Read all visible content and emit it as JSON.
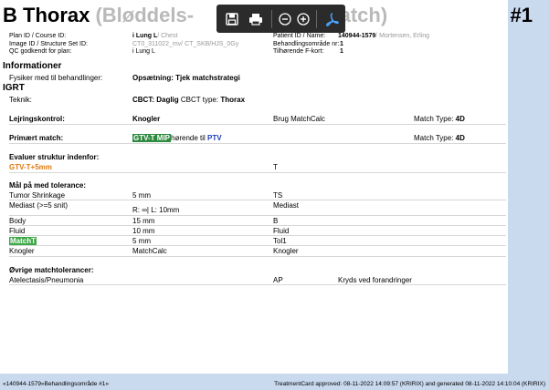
{
  "header": {
    "title_main": "B Thorax",
    "title_ghost_left": " (Bløddels-",
    "title_ghost_right": "match)",
    "number": "#1"
  },
  "toolbar": {
    "icons": [
      "save-icon",
      "print-icon",
      "zoom-out-icon",
      "zoom-in-icon",
      "pdf-icon"
    ]
  },
  "meta": {
    "plan_label": "Plan ID / Course ID:",
    "plan_value": "i Lung L",
    "plan_sub": "/ Chest",
    "image_label": "Image ID / Structure Set ID:",
    "image_value": "CT0_311022_mv/ CT_SKB/HJS_0Gy",
    "qc_label": "QC godkendt for plan:",
    "qc_value": "i Lung L",
    "patient_label": "Patient ID / Name:",
    "patient_id": "140944-1579",
    "patient_name": "/ Mortensen, Erling",
    "area_label": "Behandlingsområde nr:",
    "area_value": "1",
    "fcard_label": "Tilhørende F-kort:",
    "fcard_value": "1"
  },
  "info": {
    "heading": "Informationer",
    "fysiker_label": "Fysiker med til behandlinger:",
    "fysiker_value": "Opsætning: Tjek matchstrategi"
  },
  "igrt": {
    "heading": "IGRT",
    "teknik_label": "Teknik:",
    "teknik_value": "CBCT: Daglig",
    "cbct_type_label": "CBCT type:",
    "cbct_type_value": "Thorax",
    "lejring_label": "Lejringskontrol:",
    "lejring_value": "Knogler",
    "lejring_calc": "Brug MatchCalc",
    "lejring_type_label": "Match Type:",
    "lejring_type_value": "4D",
    "primaer_label": "Primært match:",
    "primaer_value": "GTV-T MIP",
    "primaer_mid": "hørende til",
    "primaer_ptv": "PTV",
    "primaer_type_label": "Match Type:",
    "primaer_type_value": "4D"
  },
  "evaluer": {
    "heading": "Evaluer struktur indenfor:",
    "structure": "GTV-T+5mm",
    "value": "T"
  },
  "tolerance": {
    "heading": "Mål på med tolerance:",
    "rows": [
      {
        "name": "Tumor Shrinkage",
        "value": "5 mm",
        "ref": "TS"
      },
      {
        "name": "Mediast (>=5 snit)",
        "value": "R: ∞| L: 10mm",
        "ref": "Mediast"
      },
      {
        "name": "Body",
        "value": "15 mm",
        "ref": "B"
      },
      {
        "name": "Fluid",
        "value": "10 mm",
        "ref": "Fluid"
      },
      {
        "name": "MatchT",
        "value": "5 mm",
        "ref": "Tol1"
      },
      {
        "name": "Knogler",
        "value": "MatchCalc",
        "ref": "Knogler"
      }
    ]
  },
  "other": {
    "heading": "Øvrige matchtolerancer:",
    "name": "Atelectasis/Pneumonia",
    "ref": "AP",
    "note": "Kryds ved forandringer"
  },
  "footer": {
    "left": "«140944-1579»Behandlingsområde #1»",
    "right": "TreatmentCard approved: 08-11-2022 14:09:57 (KRIRIX) and generated 08-11-2022 14:10:04 (KRIRIX)"
  },
  "colors": {
    "background": "#c9d9ee",
    "highlight_green": "#2d8a3e",
    "ptv_blue": "#1a3db8",
    "gtv_orange": "#e07a10",
    "toolbar": "#2b2b2b"
  }
}
